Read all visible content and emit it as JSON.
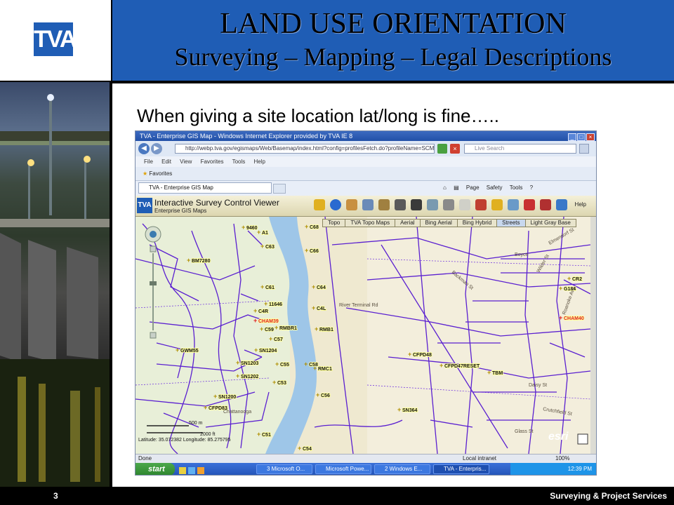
{
  "header": {
    "logo_text": "TVA",
    "title": "LAND USE ORIENTATION",
    "subtitle": "Surveying – Mapping – Legal Descriptions"
  },
  "body": {
    "bullet": "When giving a site location lat/long is fine….."
  },
  "browser": {
    "window_title": "TVA - Enterprise GIS Map - Windows Internet Explorer provided by TVA IE 8",
    "address": "http://webp.tva.gov/egismaps/Web/Basemap/index.html?config=profilesFetch.do?profileName=SCMap&request",
    "search_placeholder": "Live Search",
    "menu": [
      "File",
      "Edit",
      "View",
      "Favorites",
      "Tools",
      "Help"
    ],
    "favorites_label": "Favorites",
    "tab_label": "TVA - Enterprise GIS Map",
    "commands": [
      "Page",
      "Safety",
      "Tools"
    ],
    "status_left": "Done",
    "status_zone": "Local intranet",
    "status_zoom": "100%"
  },
  "app": {
    "logo_text": "TVA",
    "title": "Interactive Survey Control Viewer",
    "subtitle": "Enterprise GIS Maps",
    "help": "Help",
    "basemap_tabs": [
      "Topo",
      "TVA Topo Maps",
      "Aerial",
      "Bing Aerial",
      "Bing Hybrid",
      "Streets",
      "Light Gray Base"
    ],
    "active_tab": "Streets"
  },
  "map": {
    "scale_label": "500 m",
    "scale_label2": "2000 ft",
    "coords": "Latitude: 35.072382  Longitude: 85.275795",
    "esri": "esri",
    "labels": [
      {
        "text": "9460"
      },
      {
        "text": "A1"
      },
      {
        "text": "C68"
      },
      {
        "text": "C63"
      },
      {
        "text": "C66"
      },
      {
        "text": "BM7280"
      },
      {
        "text": "C61"
      },
      {
        "text": "C64"
      },
      {
        "text": "11646"
      },
      {
        "text": "C4L"
      },
      {
        "text": "C4R"
      },
      {
        "text": "CHAM39"
      },
      {
        "text": "RMBR1"
      },
      {
        "text": "RMB1"
      },
      {
        "text": "C59"
      },
      {
        "text": "C57"
      },
      {
        "text": "GWM55"
      },
      {
        "text": "SN1204"
      },
      {
        "text": "SN1203"
      },
      {
        "text": "C55"
      },
      {
        "text": "C58"
      },
      {
        "text": "RMC1"
      },
      {
        "text": "SN1202"
      },
      {
        "text": "C53"
      },
      {
        "text": "C56"
      },
      {
        "text": "SN1200"
      },
      {
        "text": "CFPD83"
      },
      {
        "text": "C51"
      },
      {
        "text": "C54"
      },
      {
        "text": "CFPD48"
      },
      {
        "text": "CFPD47RESET"
      },
      {
        "text": "TBM"
      },
      {
        "text": "SN364"
      },
      {
        "text": "CR2"
      },
      {
        "text": "G184"
      },
      {
        "text": "CHAM40"
      }
    ],
    "streets": [
      {
        "text": "River Terminal Rd"
      },
      {
        "text": "Boyce"
      },
      {
        "text": "Wilder St"
      },
      {
        "text": "Elmendorf St"
      },
      {
        "text": "Backman St"
      },
      {
        "text": "Roanoke Ave"
      },
      {
        "text": "Daisy St"
      },
      {
        "text": "Crutchfield St"
      },
      {
        "text": "Glass St"
      },
      {
        "text": "Chattanooga"
      }
    ]
  },
  "taskbar": {
    "start": "start",
    "tasks": [
      "3 Microsoft O...",
      "Microsoft Powe...",
      "2 Windows E...",
      "TVA - Enterpris..."
    ],
    "clock": "12:39 PM"
  },
  "footer": {
    "page_number": "3",
    "text": "Surveying & Project Services"
  },
  "colors": {
    "brand_blue": "#1f5db5",
    "street_purple": "#5a1fd0",
    "river": "#9ec6e8",
    "marker_red": "#e02020"
  }
}
